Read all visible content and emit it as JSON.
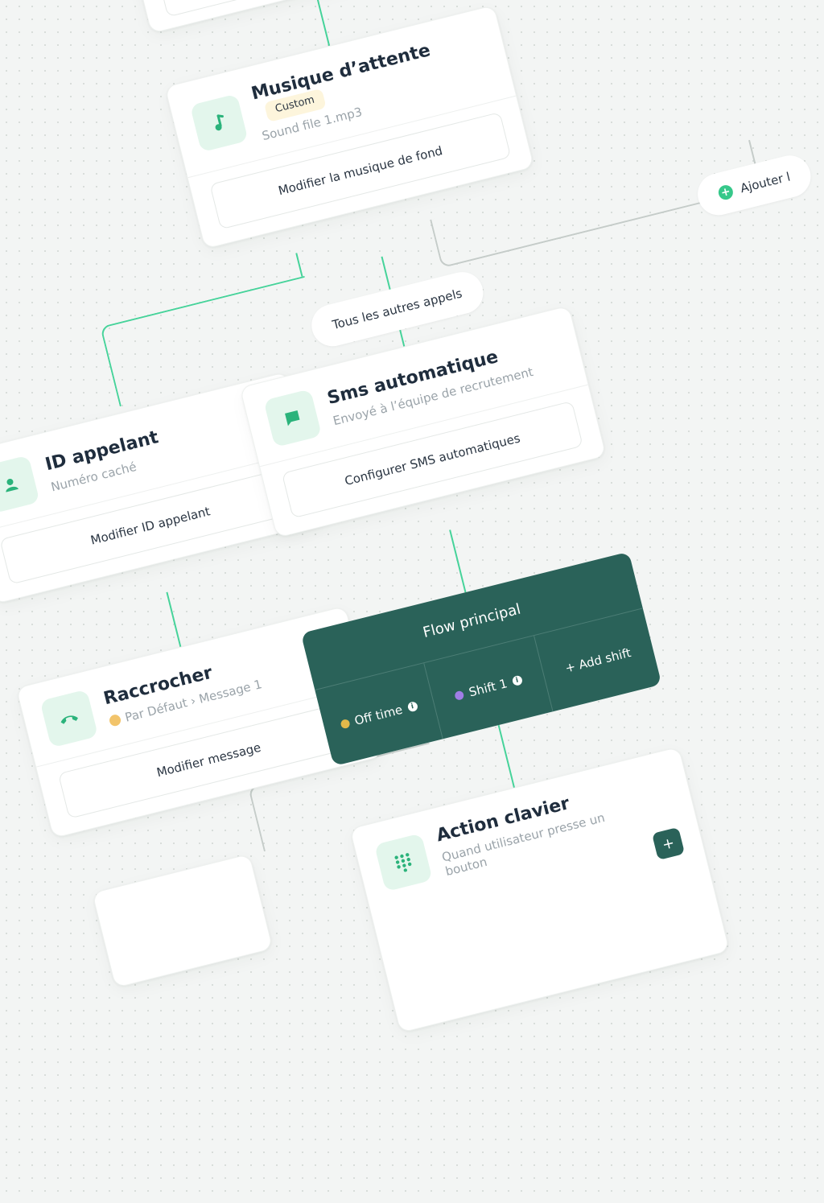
{
  "colors": {
    "accent": "#46d39a",
    "flow_bg": "#2a6259",
    "icon_bg": "#e3f6ec",
    "badge_bg": "#fdf5dc"
  },
  "cards": {
    "musique": {
      "title": "Musique d’attente",
      "badge": "Custom",
      "subtitle": "Sound file 1.mp3",
      "button": "Modifier la musique de fond",
      "icon": "music-note-icon"
    },
    "sms": {
      "title": "Sms automatique",
      "subtitle": "Envoyé à l’équipe de recrutement",
      "button": "Configurer SMS automatiques",
      "icon": "chat-bubble-icon"
    },
    "id_appelant": {
      "title": "ID appelant",
      "subtitle": "Numéro caché",
      "button": "Modifier ID appelant"
    },
    "raccrocher": {
      "title": "Raccrocher",
      "subtitle": "Par Défaut › Message 1",
      "button": "Modifier message",
      "icon": "phone-hangup-icon"
    },
    "clavier": {
      "title": "Action clavier",
      "subtitle": "Quand utilisateur presse un bouton",
      "icon": "keypad-icon"
    }
  },
  "pills": {
    "autres_appels": "Tous les autres appels",
    "ajouter": "Ajouter l"
  },
  "flow": {
    "title": "Flow principal",
    "off_time": "Off time",
    "shift1": "Shift 1",
    "add_shift": "+ Add shift",
    "off_time_color": "#e2b94a",
    "shift1_color": "#a07de6"
  },
  "mini_button": "+"
}
